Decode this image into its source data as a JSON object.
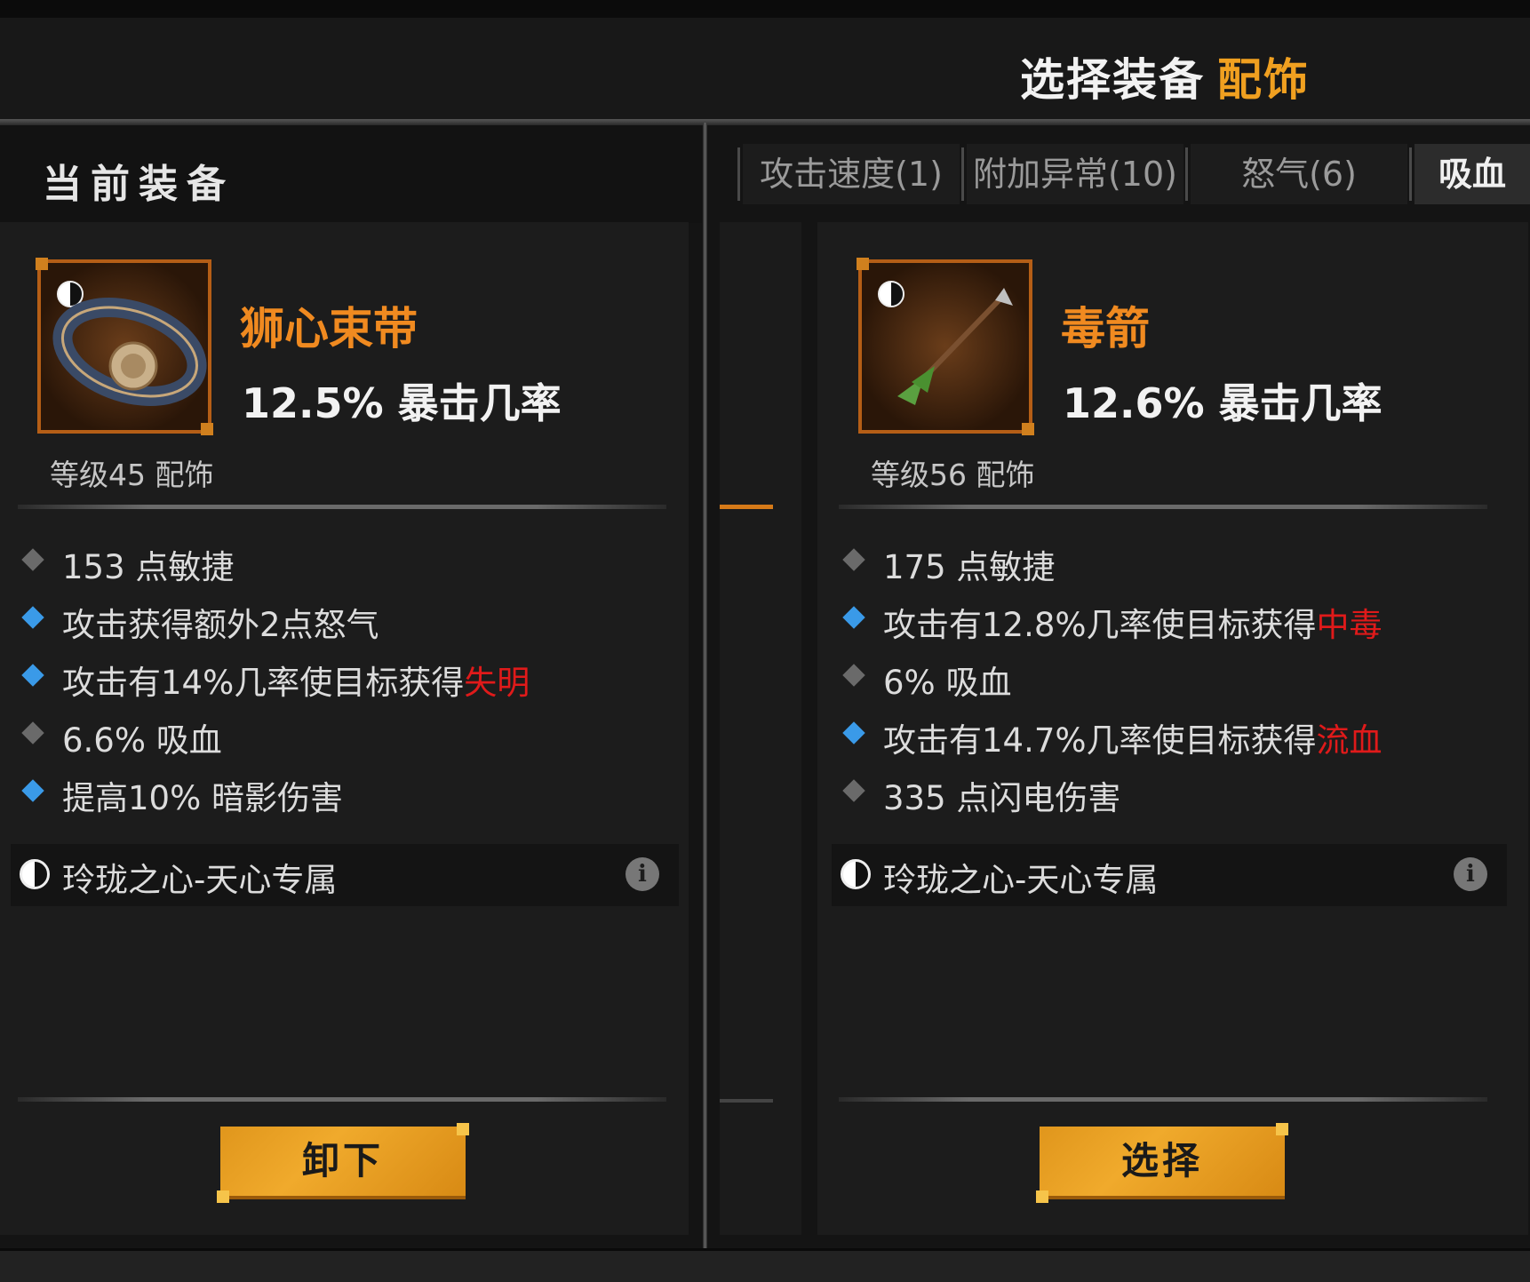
{
  "header": {
    "title": "选择装备",
    "title_accent": "配饰"
  },
  "left": {
    "heading": "当前装备",
    "item": {
      "icon": "belt-icon",
      "name": "狮心束带",
      "main_stat": "12.5% 暴击几率",
      "level": "等级45 配饰",
      "stats": [
        {
          "bullet": "gray",
          "text": "153 点敏捷",
          "highlight": ""
        },
        {
          "bullet": "blue",
          "text": "攻击获得额外2点怒气",
          "highlight": ""
        },
        {
          "bullet": "blue",
          "text": "攻击有14%几率使目标获得",
          "highlight": "失明"
        },
        {
          "bullet": "gray",
          "text": "6.6% 吸血",
          "highlight": ""
        },
        {
          "bullet": "blue",
          "text": "提高10% 暗影伤害",
          "highlight": ""
        }
      ],
      "set": "玲珑之心-天心专属"
    },
    "button": "卸下"
  },
  "tabs": [
    {
      "label": "攻击速度(1)",
      "active": false
    },
    {
      "label": "附加异常(10)",
      "active": false
    },
    {
      "label": "怒气(6)",
      "active": false
    },
    {
      "label": "吸血",
      "active": true
    }
  ],
  "right": {
    "item": {
      "icon": "arrow-icon",
      "name": "毒箭",
      "main_stat": "12.6% 暴击几率",
      "level": "等级56 配饰",
      "stats": [
        {
          "bullet": "gray",
          "text": "175 点敏捷",
          "highlight": ""
        },
        {
          "bullet": "blue",
          "text": "攻击有12.8%几率使目标获得",
          "highlight": "中毒"
        },
        {
          "bullet": "gray",
          "text": "6% 吸血",
          "highlight": ""
        },
        {
          "bullet": "blue",
          "text": "攻击有14.7%几率使目标获得",
          "highlight": "流血"
        },
        {
          "bullet": "gray",
          "text": "335 点闪电伤害",
          "highlight": ""
        }
      ],
      "set": "玲珑之心-天心专属"
    },
    "button": "选择"
  },
  "colors": {
    "accent": "#f0a020",
    "item_name": "#f08a20",
    "debuff": "#e01a1a",
    "blue_bullet": "#3a9ae8",
    "gray_bullet": "#6a6a6a"
  }
}
